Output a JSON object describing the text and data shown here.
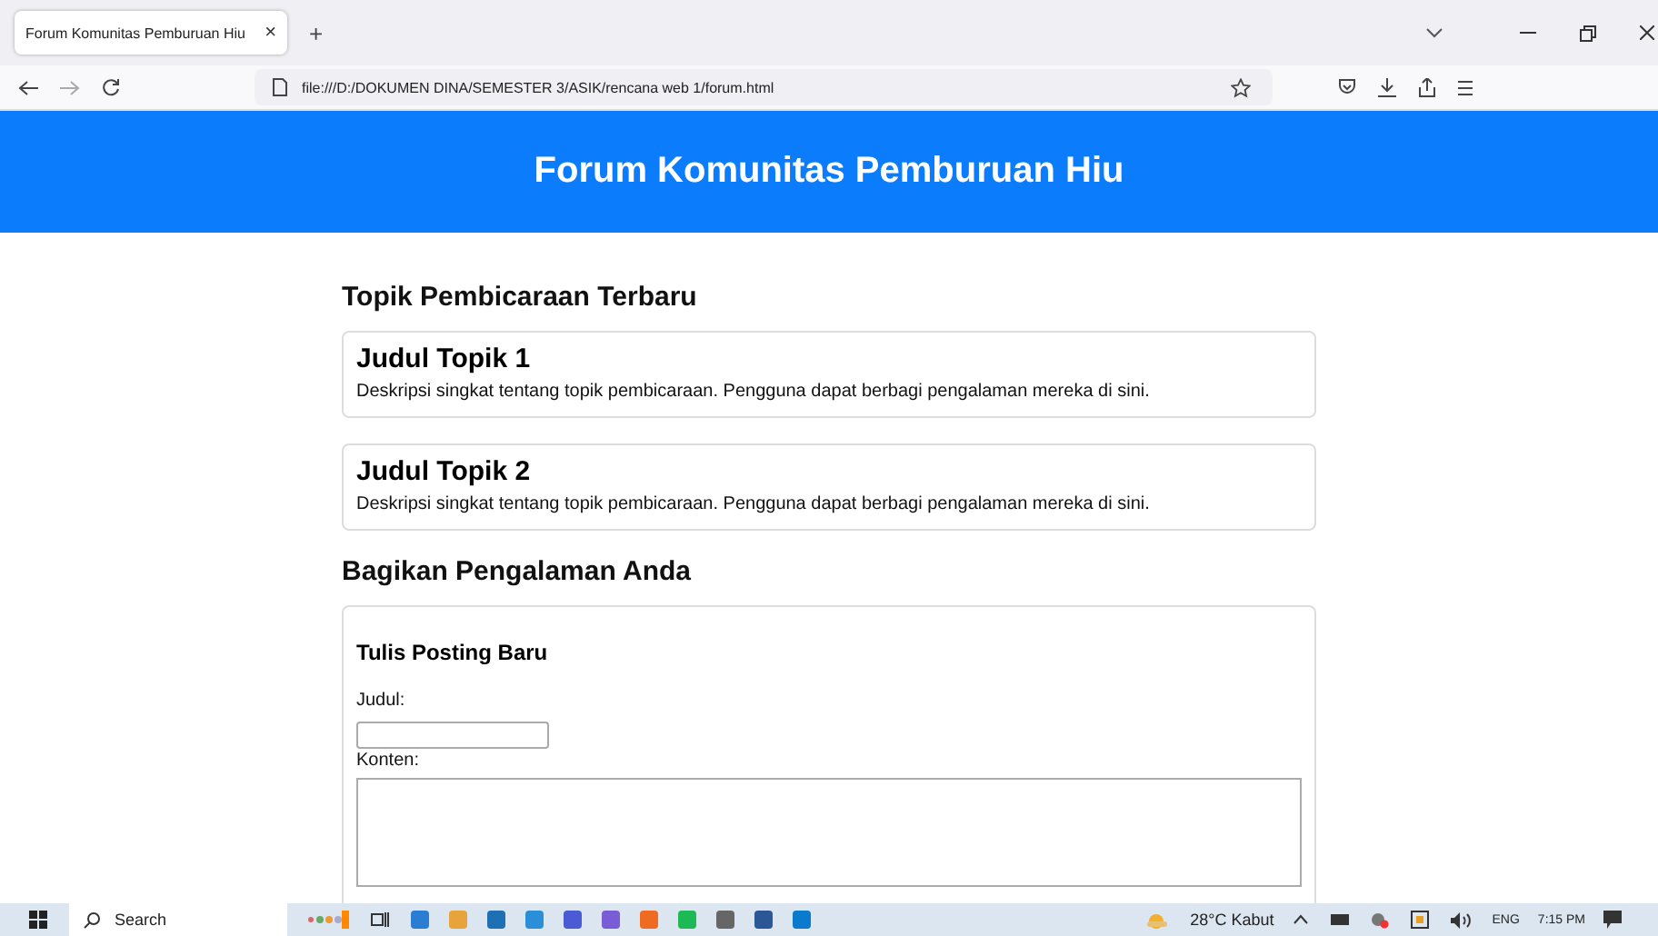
{
  "browser": {
    "tab": {
      "title": "Forum Komunitas Pemburuan Hiu",
      "close": "×"
    },
    "new_tab": "+",
    "address": "file:///D:/DOKUMEN DINA/SEMESTER 3/ASIK/rencana web 1/forum.html"
  },
  "header": {
    "title": "Forum Komunitas Pemburuan Hiu"
  },
  "topics": {
    "heading": "Topik Pembicaraan Terbaru",
    "items": [
      {
        "title": "Judul Topik 1",
        "description": "Deskripsi singkat tentang topik pembicaraan. Pengguna dapat berbagi pengalaman mereka di sini."
      },
      {
        "title": "Judul Topik 2",
        "description": "Deskripsi singkat tentang topik pembicaraan. Pengguna dapat berbagi pengalaman mereka di sini."
      }
    ]
  },
  "share": {
    "heading": "Bagikan Pengalaman Anda",
    "form": {
      "title": "Tulis Posting Baru",
      "fields": [
        {
          "label": "Judul:",
          "kind": "text"
        },
        {
          "label": "Konten:",
          "kind": "textarea"
        }
      ]
    }
  },
  "taskbar": {
    "search_placeholder": "Search",
    "weather": "28°C Kabut",
    "language": "ENG",
    "time": "7:15 PM"
  }
}
